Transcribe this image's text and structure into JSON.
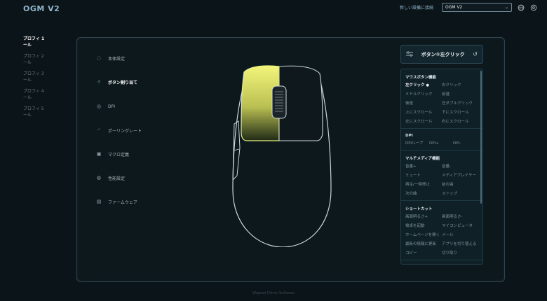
{
  "brand": "OGM V2",
  "header": {
    "connect_label": "新しい設備に接続",
    "device_selected": "OGM V2",
    "icons": [
      "chevron-down-icon",
      "globe-icon",
      "settings-icon"
    ]
  },
  "profiles": [
    {
      "label": "プロフィ 1\nール",
      "active": true
    },
    {
      "label": "プロフィ 2\nール",
      "active": false
    },
    {
      "label": "プロフィ 3\nール",
      "active": false
    },
    {
      "label": "プロフィ 4\nール",
      "active": false
    },
    {
      "label": "プロフィ 5\nール",
      "active": false
    }
  ],
  "menu": [
    {
      "label": "本体設定",
      "icon": "power-icon",
      "active": false
    },
    {
      "label": "ボタン割り当て",
      "icon": "pointer-icon",
      "active": true
    },
    {
      "label": "DPI",
      "icon": "dpi-target-icon",
      "active": false
    },
    {
      "label": "ポーリングレート",
      "icon": "polling-gauge-icon",
      "active": false
    },
    {
      "label": "マクロ定義",
      "icon": "macro-icon",
      "active": false
    },
    {
      "label": "性能設定",
      "icon": "performance-icon",
      "active": false
    },
    {
      "label": "ファームウェア",
      "icon": "firmware-folder-icon",
      "active": false
    }
  ],
  "mouse": {
    "highlight_color": "#eef070",
    "highlighted_button": "left-button"
  },
  "assign": {
    "header_title": "ボタン①左クリック",
    "header_icons": [
      "sliders-icon",
      "reset-icon"
    ],
    "sections": [
      {
        "title": "マウスボタン機能",
        "columns": 2,
        "options": [
          "左クリック",
          "右クリック",
          "ミドルクリック",
          "前進",
          "後退",
          "左ダブルクリック",
          "上にスクロール",
          "下にスクロール",
          "左にスクロール",
          "右にスクロール"
        ],
        "selected_index": 0,
        "selected_marker": "●"
      },
      {
        "title": "DPI",
        "columns": 3,
        "options": [
          "DPIループ",
          "DPI+",
          "DPI-"
        ]
      },
      {
        "title": "マルチメディア機能",
        "columns": 2,
        "options": [
          "音量+",
          "音量-",
          "ミュート",
          "メディアプレイヤー",
          "再生/一時停止",
          "前の曲",
          "次の曲",
          "ストップ"
        ]
      },
      {
        "title": "ショートカット",
        "columns": 2,
        "options": [
          "画面明るさ+",
          "画面明るさ-",
          "電卓を起動",
          "マイコンピュータ",
          "ホームページを開く",
          "メール",
          "最新の情報に更新",
          "アプリを切り替える",
          "コピー",
          "切り取り"
        ]
      }
    ]
  },
  "footer": "Wopowi Driver Software"
}
